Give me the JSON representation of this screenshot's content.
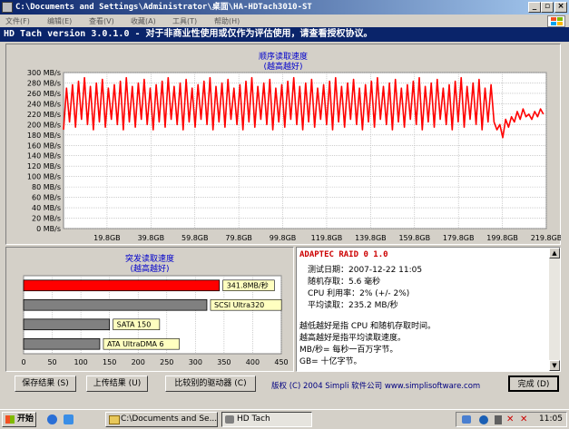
{
  "window": {
    "title": "C:\\Documents and Settings\\Administrator\\桌面\\HA-HDTach3010-ST",
    "menu": [
      "文件(F)",
      "编辑(E)",
      "查看(V)",
      "收藏(A)",
      "工具(T)",
      "帮助(H)"
    ]
  },
  "app": {
    "header": "HD Tach version 3.0.1.0  - 对于非商业性使用或仅作为评估使用，请查看授权协议。"
  },
  "sequential_chart": {
    "title_line1": "顺序读取速度",
    "title_line2": "(越高越好)"
  },
  "burst_chart": {
    "title_line1": "突发读取速度",
    "title_line2": "(越高越好)"
  },
  "chart_data": [
    {
      "type": "line",
      "title": "顺序读取速度 (越高越好)",
      "ylim": [
        0,
        300
      ],
      "y_ticks": [
        "0 MB/s",
        "20 MB/s",
        "40 MB/s",
        "60 MB/s",
        "80 MB/s",
        "100 MB/s",
        "120 MB/s",
        "140 MB/s",
        "160 MB/s",
        "180 MB/s",
        "200 MB/s",
        "220 MB/s",
        "240 MB/s",
        "260 MB/s",
        "280 MB/s",
        "300 MB/s"
      ],
      "x_ticks": [
        "19.8GB",
        "39.8GB",
        "59.8GB",
        "79.8GB",
        "99.8GB",
        "119.8GB",
        "139.8GB",
        "159.8GB",
        "179.8GB",
        "199.8GB",
        "219.8GB"
      ],
      "xlim": [
        0,
        219.8
      ],
      "grid": true,
      "color": "#ff0000",
      "series": [
        {
          "x_start": 0,
          "x_end": 219.8,
          "oscillation_count": 72,
          "high_range": [
            270,
            290
          ],
          "low_range": [
            190,
            210
          ],
          "tail_start_x": 196,
          "tail_values": [
            205,
            190,
            200,
            175,
            210,
            195,
            215,
            205,
            225,
            210,
            230,
            215,
            220,
            210,
            225,
            215,
            230,
            220
          ]
        }
      ]
    },
    {
      "type": "bar",
      "orientation": "horizontal",
      "title": "突发读取速度 (越高越好)",
      "xlim": [
        0,
        450
      ],
      "x_ticks": [
        "0",
        "50",
        "100",
        "150",
        "200",
        "250",
        "300",
        "350",
        "400",
        "450"
      ],
      "grid": true,
      "categories": [
        "341.8MB/秒",
        "SCSI Ultra320",
        "SATA 150",
        "ATA UltraDMA 6"
      ],
      "values": [
        341.8,
        320,
        150,
        133
      ],
      "colors": [
        "#ff0000",
        "#808080",
        "#808080",
        "#808080"
      ]
    }
  ],
  "info": {
    "drive_name": "ADAPTEC RAID 0 1.0",
    "test_date": "测试日期：2007-12-22      11:05",
    "random_access": "随机存取：5.6 毫秒",
    "cpu_usage": "CPU 利用率：2% (+/- 2%)",
    "avg_read": "平均读取：235.2 MB/秒",
    "note1": "越低越好是指 CPU 和随机存取时间。",
    "note2": "越高越好是指平均读取速度。",
    "note3": "MB/秒= 每秒一百万字节。",
    "note4": "GB= 十亿字节。"
  },
  "buttons": {
    "save": "保存结果 (S)",
    "upload": "上传结果 (U)",
    "compare": "比较别的驱动器 (C)",
    "done": "完成 (D)"
  },
  "copyright": "版权  (C) 2004 Simpli 软件公司 www.simplisoftware.com",
  "taskbar": {
    "start": "开始",
    "task1": "C:\\Documents and Se...",
    "task2": "HD Tach",
    "clock": "11:05"
  }
}
